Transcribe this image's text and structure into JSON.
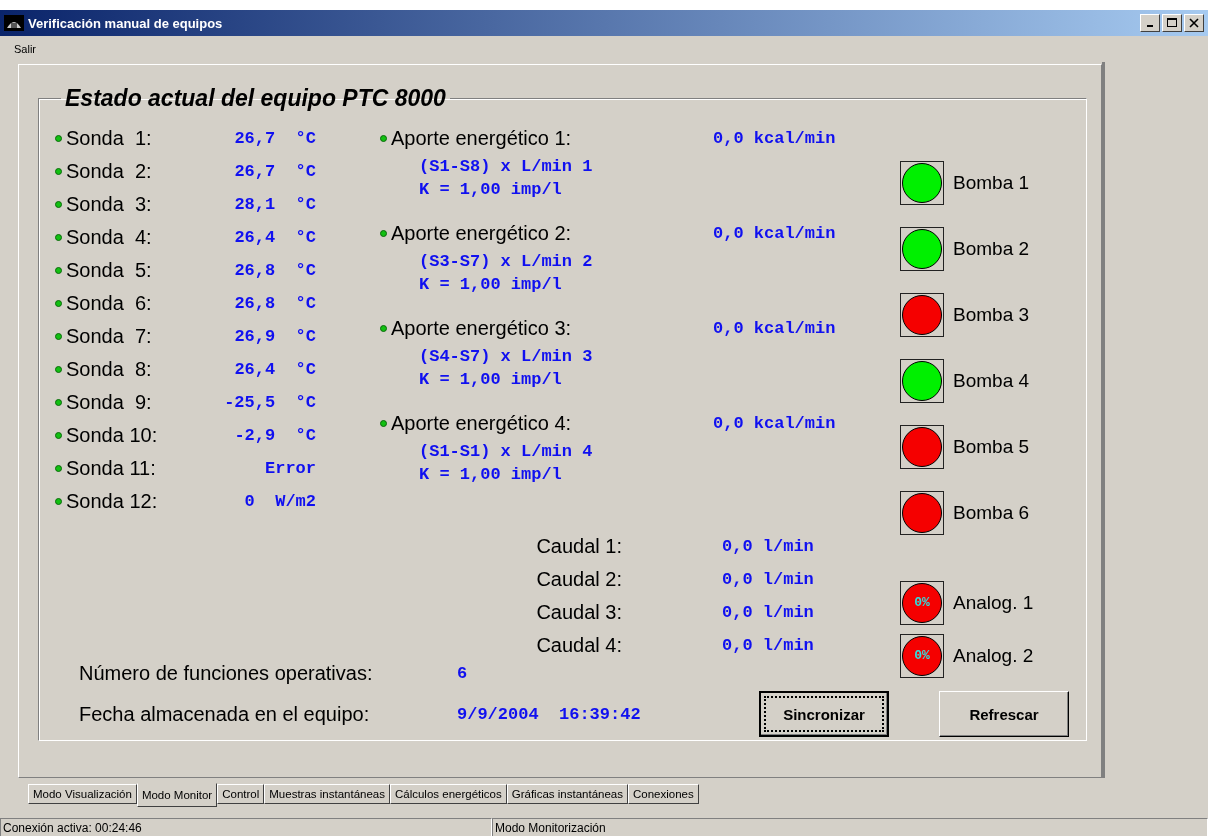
{
  "window": {
    "title": "Verificación manual de equipos"
  },
  "menu": [
    "Salir"
  ],
  "group": {
    "title": "Estado actual del equipo PTC 8000",
    "probes": [
      {
        "label": "Sonda  1:",
        "value": "26,7  °C"
      },
      {
        "label": "Sonda  2:",
        "value": "26,7  °C"
      },
      {
        "label": "Sonda  3:",
        "value": "28,1  °C"
      },
      {
        "label": "Sonda  4:",
        "value": "26,4  °C"
      },
      {
        "label": "Sonda  5:",
        "value": "26,8  °C"
      },
      {
        "label": "Sonda  6:",
        "value": "26,8  °C"
      },
      {
        "label": "Sonda  7:",
        "value": "26,9  °C"
      },
      {
        "label": "Sonda  8:",
        "value": "26,4  °C"
      },
      {
        "label": "Sonda  9:",
        "value": "-25,5  °C"
      },
      {
        "label": "Sonda 10:",
        "value": "-2,9  °C"
      },
      {
        "label": "Sonda 11:",
        "value": "Error"
      },
      {
        "label": "Sonda 12:",
        "value": "0  W/m2"
      }
    ],
    "energy": [
      {
        "label": "Aporte energético 1:",
        "value": "0,0 kcal/min",
        "formula": "(S1-S8) x L/min 1",
        "factor": "K = 1,00 imp/l"
      },
      {
        "label": "Aporte energético 2:",
        "value": "0,0 kcal/min",
        "formula": "(S3-S7) x L/min 2",
        "factor": "K = 1,00 imp/l"
      },
      {
        "label": "Aporte energético 3:",
        "value": "0,0 kcal/min",
        "formula": "(S4-S7) x L/min 3",
        "factor": "K = 1,00 imp/l"
      },
      {
        "label": "Aporte energético 4:",
        "value": "0,0 kcal/min",
        "formula": "(S1-S1) x L/min 4",
        "factor": "K = 1,00 imp/l"
      }
    ],
    "flows": [
      {
        "label": "Caudal 1:",
        "value": "0,0 l/min"
      },
      {
        "label": "Caudal 2:",
        "value": "0,0 l/min"
      },
      {
        "label": "Caudal 3:",
        "value": "0,0 l/min"
      },
      {
        "label": "Caudal 4:",
        "value": "0,0 l/min"
      }
    ],
    "pumps": [
      {
        "label": "Bomba 1",
        "on": true
      },
      {
        "label": "Bomba 2",
        "on": true
      },
      {
        "label": "Bomba 3",
        "on": false
      },
      {
        "label": "Bomba 4",
        "on": true
      },
      {
        "label": "Bomba 5",
        "on": false
      },
      {
        "label": "Bomba 6",
        "on": false
      }
    ],
    "analogs": [
      {
        "label": "Analog. 1",
        "reading": "0%"
      },
      {
        "label": "Analog. 2",
        "reading": "0%"
      }
    ],
    "functions": {
      "label": "Número de funciones operativas:",
      "value": "6"
    },
    "date": {
      "label": "Fecha almacenada en el equipo:",
      "value": "9/9/2004  16:39:42"
    },
    "buttons": [
      {
        "label": "Sincronizar",
        "focused": true
      },
      {
        "label": "Refrescar",
        "focused": false
      }
    ]
  },
  "tabs": [
    {
      "label": "Modo Visualización",
      "selected": false
    },
    {
      "label": "Modo Monitor",
      "selected": true
    },
    {
      "label": "Control",
      "selected": false
    },
    {
      "label": "Muestras instantáneas",
      "selected": false
    },
    {
      "label": "Cálculos energéticos",
      "selected": false
    },
    {
      "label": "Gráficas instantáneas",
      "selected": false
    },
    {
      "label": "Conexiones",
      "selected": false
    }
  ],
  "status_bar": [
    "Conexión activa: 00:24:46",
    "Modo Monitorización"
  ]
}
